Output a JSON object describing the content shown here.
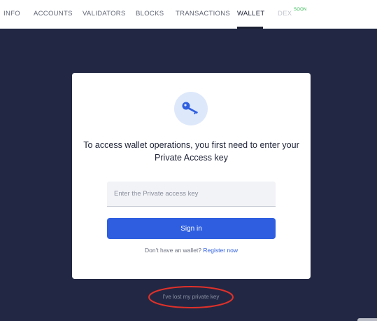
{
  "nav": {
    "items": [
      {
        "label": "INFO"
      },
      {
        "label": "ACCOUNTS"
      },
      {
        "label": "VALIDATORS"
      },
      {
        "label": "BLOCKS"
      },
      {
        "label": "TRANSACTIONS"
      },
      {
        "label": "WALLET"
      },
      {
        "label": "DEX"
      }
    ],
    "active": "WALLET",
    "soon_badge": "SOON"
  },
  "wallet": {
    "icon": "key-icon",
    "headline": "To access wallet operations, you first need to enter your Private Access key",
    "input_placeholder": "Enter the Private access key",
    "input_value": "",
    "signin_label": "Sign in",
    "no_wallet_text": "Don't have an wallet?",
    "register_label": "Register now",
    "lost_key_label": "I've lost my private key"
  },
  "colors": {
    "background": "#222843",
    "accent": "#2f5fe0",
    "soon_badge": "#2db84d",
    "highlight_ellipse": "#e0302a"
  }
}
